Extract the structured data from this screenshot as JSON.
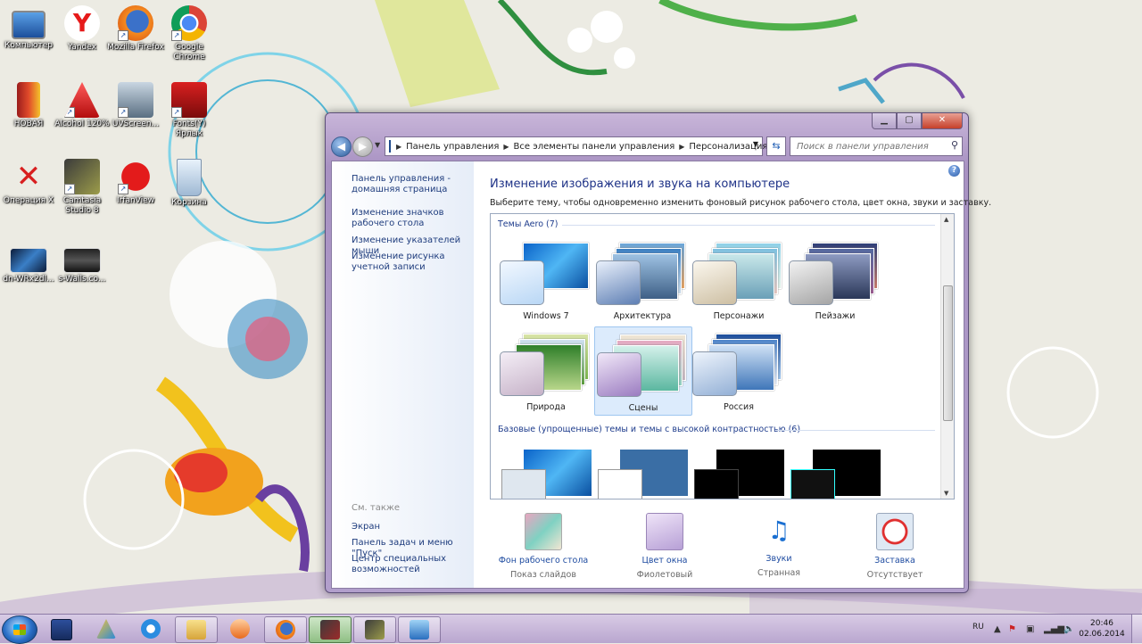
{
  "desktop": {
    "icons": [
      {
        "label": "Компьютер"
      },
      {
        "label": "Yandex"
      },
      {
        "label": "Mozilla Firefox"
      },
      {
        "label": "Google Chrome"
      },
      {
        "label": "НОВАЯ"
      },
      {
        "label": "Alcohol 120%"
      },
      {
        "label": "UVScreen..."
      },
      {
        "label": "Fonts(Y) Ярлык"
      },
      {
        "label": "Операция Х"
      },
      {
        "label": "Camtasia Studio 8"
      },
      {
        "label": "IrfanView"
      },
      {
        "label": "Корзина"
      },
      {
        "label": "dn-WRx2dl..."
      },
      {
        "label": "s-Walls.co..."
      }
    ]
  },
  "window": {
    "address": {
      "crumbs": [
        "Панель управления",
        "Все элементы панели управления",
        "Персонализация"
      ]
    },
    "search": {
      "placeholder": "Поиск в панели управления"
    },
    "sidebar": {
      "links": [
        "Панель управления - домашняя страница",
        "Изменение значков рабочего стола",
        "Изменение указателей мыши",
        "Изменение рисунка учетной записи"
      ],
      "see_also_title": "См. также",
      "see_also": [
        "Экран",
        "Панель задач и меню \"Пуск\"",
        "Центр специальных возможностей"
      ]
    },
    "main": {
      "title": "Изменение изображения и звука на компьютере",
      "subtitle": "Выберите тему, чтобы одновременно изменить фоновый рисунок рабочего стола, цвет окна, звуки и заставку.",
      "aero_header": "Темы Aero (7)",
      "aero_themes": [
        {
          "name": "Windows 7"
        },
        {
          "name": "Архитектура"
        },
        {
          "name": "Персонажи"
        },
        {
          "name": "Пейзажи"
        },
        {
          "name": "Природа"
        },
        {
          "name": "Сцены",
          "selected": true
        },
        {
          "name": "Россия"
        }
      ],
      "basic_header": "Базовые (упрощенные) темы и темы с высокой контрастностью (6)",
      "options": [
        {
          "title": "Фон рабочего стола",
          "value": "Показ слайдов"
        },
        {
          "title": "Цвет окна",
          "value": "Фиолетовый"
        },
        {
          "title": "Звуки",
          "value": "Странная"
        },
        {
          "title": "Заставка",
          "value": "Отсутствует"
        }
      ]
    }
  },
  "taskbar": {
    "language": "RU",
    "time": "20:46",
    "date": "02.06.2014"
  }
}
